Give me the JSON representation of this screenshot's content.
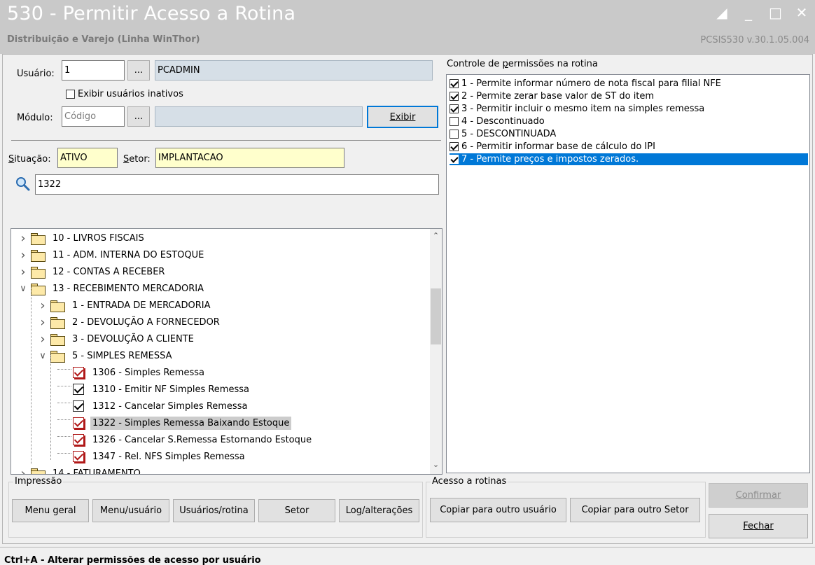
{
  "window": {
    "title": "530 - Permitir Acesso a Rotina",
    "subtitle": "Distribuição e Varejo (Linha WinThor)",
    "version": "PCSIS530  v.30.1.05.004"
  },
  "user": {
    "label": "Usuário:",
    "code": "1",
    "lookup": "...",
    "name": "PCADMIN",
    "show_inactive_label": "Exibir usuários inativos",
    "show_inactive_checked": false
  },
  "module": {
    "label": "Módulo:",
    "placeholder": "Código",
    "lookup": "...",
    "name": "",
    "show_button": "Exibir"
  },
  "situation": {
    "label": "Situação:",
    "value": "ATIVO"
  },
  "sector": {
    "label": "Setor:",
    "value": "IMPLANTACAO"
  },
  "search": {
    "value": "1322"
  },
  "tree": {
    "rows": [
      {
        "expander": ">",
        "type": "folder",
        "label": "10 - LIVROS FISCAIS"
      },
      {
        "expander": ">",
        "type": "folder",
        "label": "11 - ADM. INTERNA DO ESTOQUE"
      },
      {
        "expander": ">",
        "type": "folder",
        "label": "12 - CONTAS A RECEBER"
      },
      {
        "expander": "v",
        "type": "folder",
        "label": "13 - RECEBIMENTO MERCADORIA"
      },
      {
        "expander": ">",
        "type": "folder",
        "label": "1 - ENTRADA DE MERCADORIA"
      },
      {
        "expander": ">",
        "type": "folder",
        "label": "2 - DEVOLUÇÃO A FORNECEDOR"
      },
      {
        "expander": ">",
        "type": "folder",
        "label": "3 - DEVOLUÇÃO A CLIENTE"
      },
      {
        "expander": "v",
        "type": "folder",
        "label": "5 - SIMPLES REMESSA"
      },
      {
        "type": "check",
        "style": "red",
        "label": "1306 - Simples Remessa"
      },
      {
        "type": "check",
        "style": "black",
        "label": "1310 - Emitir NF Simples Remessa"
      },
      {
        "type": "check",
        "style": "black",
        "label": "1312 - Cancelar Simples Remessa"
      },
      {
        "type": "check",
        "style": "red",
        "label": "1322 - Simples Remessa Baixando Estoque",
        "selected": true
      },
      {
        "type": "check",
        "style": "red",
        "label": "1326 - Cancelar S.Remessa Estornando Estoque"
      },
      {
        "type": "check",
        "style": "red",
        "label": "1347 - Rel. NFS Simples Remessa"
      },
      {
        "expander": ">",
        "type": "folder",
        "label": "14 - FATURAMENTO"
      }
    ]
  },
  "permissions": {
    "title": "Controle de permissões na rotina",
    "items": [
      {
        "label": "1 - Permite informar número de nota fiscal para filial NFE",
        "checked": true
      },
      {
        "label": "2 - Permite zerar base valor de ST do item",
        "checked": true
      },
      {
        "label": "3 - Permitir incluir o mesmo item na simples remessa",
        "checked": true
      },
      {
        "label": "4 - Descontinuado",
        "checked": false
      },
      {
        "label": "5 - DESCONTINUADA",
        "checked": false
      },
      {
        "label": "6 - Permitir informar base de cálculo do IPI",
        "checked": true
      },
      {
        "label": "7 - Permite preços e impostos zerados.",
        "checked": true,
        "selected": true
      }
    ]
  },
  "printing": {
    "title": "Impressão",
    "buttons": [
      "Menu geral",
      "Menu/usuário",
      "Usuários/rotina",
      "Setor",
      "Log/alterações"
    ]
  },
  "access": {
    "title": "Acesso a rotinas",
    "copy_user": "Copiar para outro usuário",
    "copy_sector": "Copiar para outro Setor"
  },
  "actions": {
    "confirm": "Confirmar",
    "close": "Fechar"
  },
  "status": {
    "text": "Ctrl+A - Alterar permissões de acesso por usuário"
  },
  "colors": {
    "selection": "#0078d7",
    "highlight_field": "#ffffcc",
    "titlebar": "#c9c9c9"
  }
}
